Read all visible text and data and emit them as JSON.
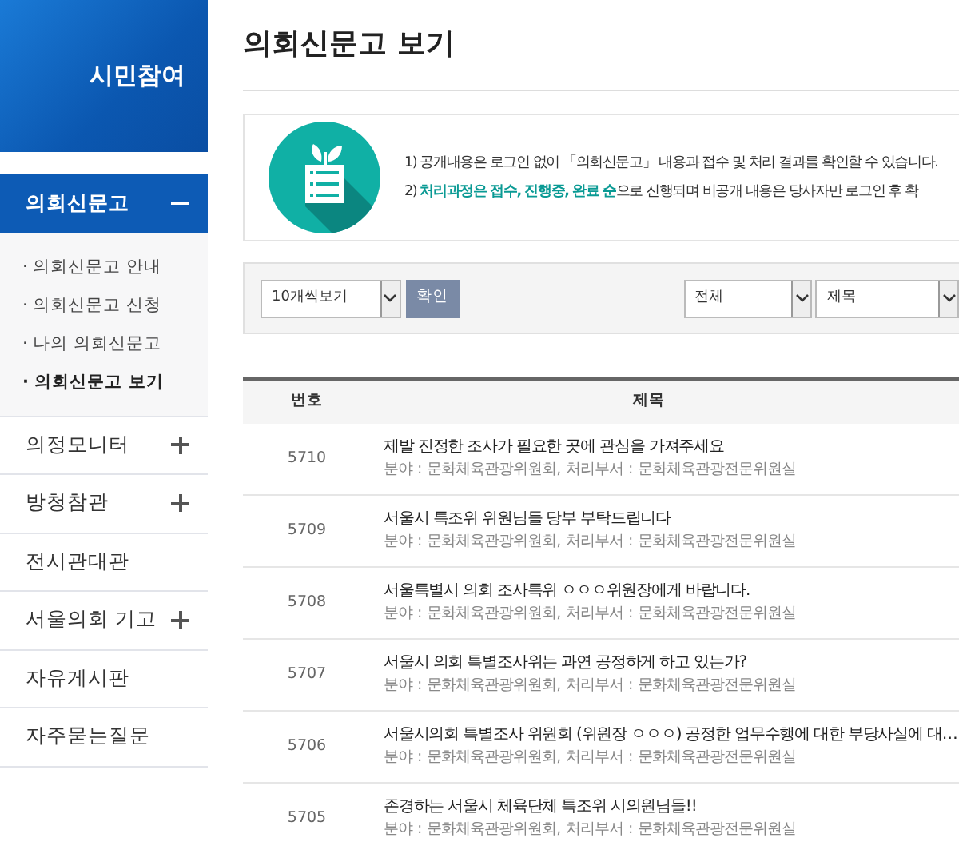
{
  "sidebar": {
    "title": "시민참여",
    "menu": [
      {
        "label": "의회신문고",
        "kind": "group",
        "selected": true,
        "expanded": true,
        "children": [
          {
            "label": "· 의회신문고 안내",
            "selected": false
          },
          {
            "label": "· 의회신문고 신청",
            "selected": false
          },
          {
            "label": "· 나의 의회신문고",
            "selected": false
          },
          {
            "label": "· 의회신문고 보기",
            "selected": true
          }
        ]
      },
      {
        "label": "의정모니터",
        "kind": "group",
        "selected": false,
        "expanded": false
      },
      {
        "label": "방청참관",
        "kind": "group",
        "selected": false,
        "expanded": false
      },
      {
        "label": "전시관대관",
        "kind": "link",
        "selected": false
      },
      {
        "label": "서울의회 기고",
        "kind": "group",
        "selected": false,
        "expanded": false
      },
      {
        "label": "자유게시판",
        "kind": "link",
        "selected": false
      },
      {
        "label": "자주묻는질문",
        "kind": "link",
        "selected": false
      }
    ]
  },
  "page_title": "의회신문고 보기",
  "notice": [
    "1) 공개내용은 로그인 없이 「의회신문고」 내용과 접수 및 처리 결과를 확인할 수 있습니다.",
    "2) **처리과정은 접수, 진행중, 완료 순**으로 진행되며 비공개 내용은 당사자만 로그인 후 확"
  ],
  "filter": {
    "page_size": "10개씩보기",
    "confirm_button": "확인",
    "category": "전체",
    "search_field": "제목"
  },
  "table": {
    "columns": [
      "번호",
      "제목"
    ],
    "rows": [
      {
        "number": "5710",
        "title": "제발 진정한 조사가 필요한 곳에 관심을 가져주세요",
        "meta": "분야 : 문화체육관광위원회, 처리부서 : 문화체육관광전문위원실"
      },
      {
        "number": "5709",
        "title": "서울시 특조위 위원님들 당부 부탁드립니다",
        "meta": "분야 : 문화체육관광위원회, 처리부서 : 문화체육관광전문위원실"
      },
      {
        "number": "5708",
        "title": "서울특별시 의회 조사특위 ㅇㅇㅇ위원장에게 바랍니다.",
        "meta": "분야 : 문화체육관광위원회, 처리부서 : 문화체육관광전문위원실"
      },
      {
        "number": "5707",
        "title": "서울시 의회 특별조사위는 과연 공정하게 하고 있는가?",
        "meta": "분야 : 문화체육관광위원회, 처리부서 : 문화체육관광전문위원실"
      },
      {
        "number": "5706",
        "title": "서울시의회 특별조사 위원회 (위원장 ㅇㅇㅇ) 공정한 업무수행에 대한 부당사실에 대…",
        "meta": "분야 : 문화체육관광위원회, 처리부서 : 문화체육관광전문위원실"
      },
      {
        "number": "5705",
        "title": "존경하는 서울시 체육단체 특조위 시의원님들!!",
        "meta": "분야 : 문화체육관광위원회, 처리부서 : 문화체육관광전문위원실"
      }
    ]
  }
}
